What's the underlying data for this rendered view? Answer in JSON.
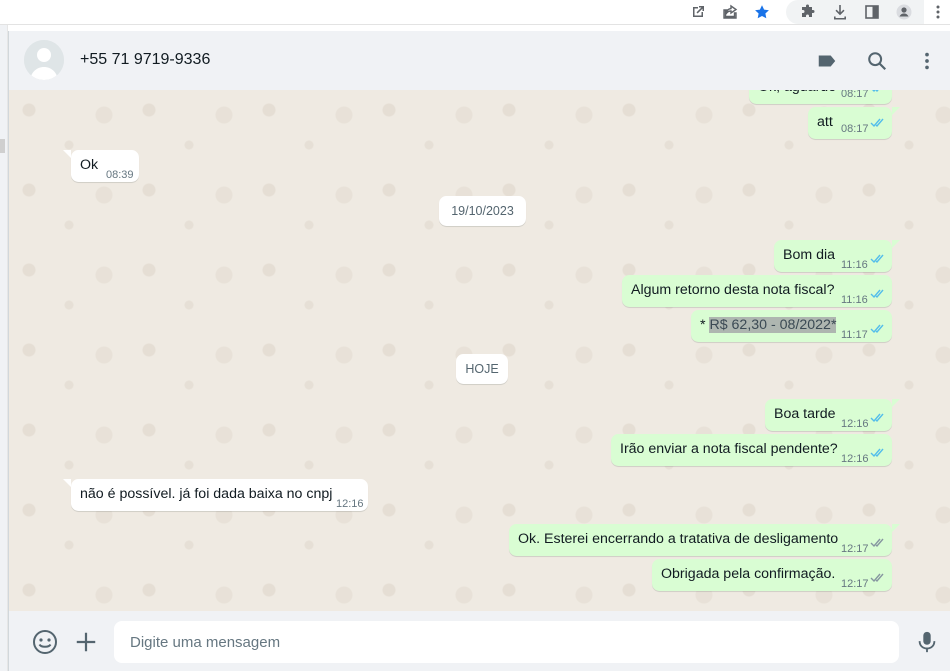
{
  "browser": {
    "icons": [
      "open-in-new-icon",
      "share-icon",
      "bookmark-star-icon",
      "extensions-icon",
      "download-icon",
      "side-panel-icon",
      "profile-icon",
      "more-vert-icon"
    ]
  },
  "header": {
    "contact_name": "+55 71 9719-9336",
    "icons": [
      "label-icon",
      "search-icon",
      "menu-dots-icon"
    ]
  },
  "messages": [
    {
      "id": "m0",
      "direction": "out",
      "text": "Ok, aguardo",
      "time": "08:17",
      "ticks": "read"
    },
    {
      "id": "m1",
      "direction": "out",
      "text": "att",
      "time": "08:17",
      "ticks": "read"
    },
    {
      "id": "m2",
      "direction": "in",
      "text": "Ok",
      "time": "08:39"
    },
    {
      "id": "d1",
      "type": "date",
      "text": "19/10/2023"
    },
    {
      "id": "m3",
      "direction": "out",
      "text": "Bom dia",
      "time": "11:16",
      "ticks": "read"
    },
    {
      "id": "m4",
      "direction": "out",
      "text": "Algum retorno desta nota fiscal?",
      "time": "11:16",
      "ticks": "read"
    },
    {
      "id": "m5",
      "direction": "out",
      "text_prefix": "* ",
      "text_highlight": "R$ 62,30 - 08/2022*",
      "time": "11:17",
      "ticks": "read"
    },
    {
      "id": "d2",
      "type": "date",
      "text": "HOJE"
    },
    {
      "id": "m6",
      "direction": "out",
      "text": "Boa tarde",
      "time": "12:16",
      "ticks": "read"
    },
    {
      "id": "m7",
      "direction": "out",
      "text": "Irão enviar a nota fiscal pendente?",
      "time": "12:16",
      "ticks": "read"
    },
    {
      "id": "m8",
      "direction": "in",
      "text": "não é possível. já foi dada baixa no cnpj",
      "time": "12:16"
    },
    {
      "id": "m9",
      "direction": "out",
      "text": "Ok. Esterei encerrando a tratativa de desligamento",
      "time": "12:17",
      "ticks": "delivered"
    },
    {
      "id": "m10",
      "direction": "out",
      "text": "Obrigada pela confirmação.",
      "time": "12:17",
      "ticks": "delivered"
    }
  ],
  "composer": {
    "placeholder": "Digite uma mensagem",
    "icons": [
      "emoji-icon",
      "attach-plus-icon",
      "microphone-icon"
    ]
  },
  "colors": {
    "outgoing_bubble": "#d9fdd3",
    "incoming_bubble": "#ffffff",
    "chat_background": "#efeae2",
    "read_ticks": "#53bdeb",
    "delivered_ticks": "#8696a0",
    "bookmark_star": "#1a73e8"
  }
}
